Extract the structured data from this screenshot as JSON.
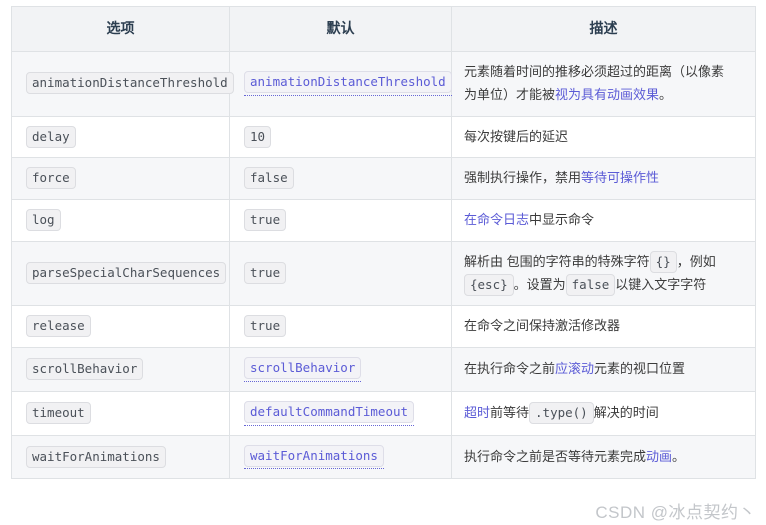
{
  "table": {
    "headers": [
      "选项",
      "默认",
      "描述"
    ],
    "rows": [
      {
        "option": "animationDistanceThreshold",
        "default": "animationDistanceThreshold",
        "default_is_link": true,
        "desc_line1_text": "元素随着时间的推移必须超过的距离（以像素",
        "desc_line2_text": "为单位）才能被",
        "desc_line2_link": "视为具有动画效果",
        "desc_line2_tail": "。"
      },
      {
        "option": "delay",
        "default": "10",
        "default_is_link": false,
        "desc_text": "每次按键后的延迟"
      },
      {
        "option": "force",
        "default": "false",
        "default_is_link": false,
        "desc_text": "强制执行操作，禁用",
        "desc_link": "等待可操作性"
      },
      {
        "option": "log",
        "default": "true",
        "default_is_link": false,
        "desc_link": "在命令日志",
        "desc_tail": "中显示命令"
      },
      {
        "option": "parseSpecialCharSequences",
        "default": "true",
        "default_is_link": false,
        "desc_l1_a": "解析由 包围的字符串的特殊字符",
        "desc_l1_code": "{}",
        "desc_l1_b": "，例如",
        "desc_l2_code": "{esc}",
        "desc_l2_a": "。设置为",
        "desc_l2_code2": "false",
        "desc_l2_b": "以键入文字字符"
      },
      {
        "option": "release",
        "default": "true",
        "default_is_link": false,
        "desc_text": "在命令之间保持激活修改器"
      },
      {
        "option": "scrollBehavior",
        "default": "scrollBehavior",
        "default_is_link": true,
        "desc_a": "在执行命令之前",
        "desc_link": "应滚动",
        "desc_b": "元素的视口位置"
      },
      {
        "option": "timeout",
        "default": "defaultCommandTimeout",
        "default_is_link": true,
        "desc_link": "超时",
        "desc_a": "前等待",
        "desc_code": ".type()",
        "desc_b": "解决的时间"
      },
      {
        "option": "waitForAnimations",
        "default": "waitForAnimations",
        "default_is_link": true,
        "desc_a": "执行命令之前是否等待元素完成",
        "desc_link": "动画",
        "desc_b": "。"
      }
    ]
  },
  "watermark": {
    "text": "CSDN @冰点契约丶"
  },
  "colors": {
    "link": "#5b5bd6",
    "header_bg": "#f2f3f5",
    "row_alt_bg": "#f6f7f9",
    "border": "#dfe2e5",
    "code_bg": "#f1f1f3",
    "text": "#3b3b3b"
  }
}
